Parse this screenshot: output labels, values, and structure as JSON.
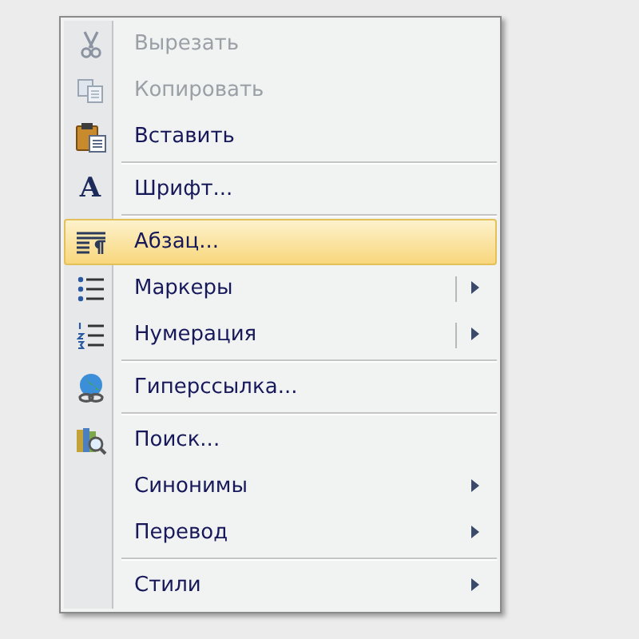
{
  "context_menu": {
    "items": [
      {
        "kind": "item",
        "label": "Вырезать",
        "disabled": true,
        "selected": false
      },
      {
        "kind": "item",
        "label": "Копировать",
        "disabled": true,
        "selected": false
      },
      {
        "kind": "item",
        "label": "Вставить",
        "disabled": false,
        "selected": false
      },
      {
        "kind": "separator"
      },
      {
        "kind": "item",
        "icon_char": "A",
        "label": "Шрифт...",
        "disabled": false,
        "selected": false
      },
      {
        "kind": "separator"
      },
      {
        "kind": "item",
        "label": "Абзац...",
        "disabled": false,
        "selected": true
      },
      {
        "kind": "item",
        "label": "Маркеры",
        "disabled": false,
        "selected": false,
        "submenu": true,
        "split": true
      },
      {
        "kind": "item",
        "label": "Нумерация",
        "disabled": false,
        "selected": false,
        "submenu": true,
        "split": true
      },
      {
        "kind": "separator"
      },
      {
        "kind": "item",
        "label": "Гиперссылка...",
        "disabled": false,
        "selected": false
      },
      {
        "kind": "separator"
      },
      {
        "kind": "item",
        "label": "Поиск...",
        "disabled": false,
        "selected": false
      },
      {
        "kind": "item",
        "label": "Синонимы",
        "disabled": false,
        "selected": false,
        "submenu": true
      },
      {
        "kind": "item",
        "label": "Перевод",
        "disabled": false,
        "selected": false,
        "submenu": true
      },
      {
        "kind": "separator"
      },
      {
        "kind": "item",
        "label": "Стили",
        "disabled": false,
        "selected": false,
        "submenu": true
      }
    ]
  }
}
